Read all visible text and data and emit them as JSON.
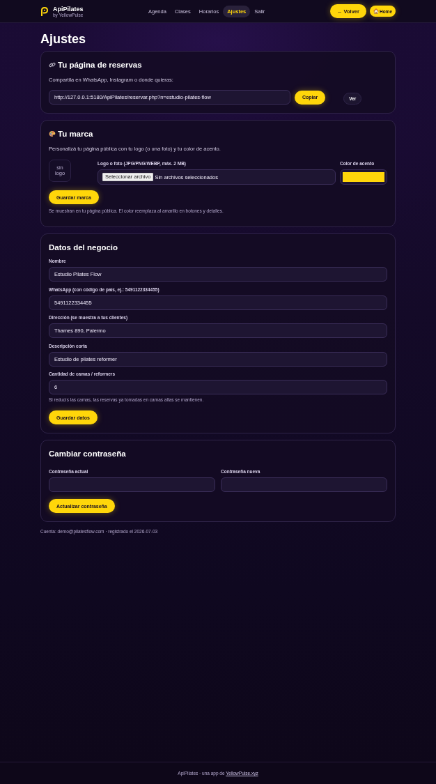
{
  "header": {
    "brand": {
      "name": "ApiPilates",
      "tagline": "by YellowPulse"
    },
    "nav": [
      {
        "label": "Agenda",
        "selected": false
      },
      {
        "label": "Clases",
        "selected": false
      },
      {
        "label": "Horarios",
        "selected": false
      },
      {
        "label": "Ajustes",
        "selected": true
      },
      {
        "label": "Salir",
        "selected": false
      }
    ],
    "actions": [
      {
        "kind": "back",
        "label": "← Volver"
      },
      {
        "kind": "home",
        "label": "Home"
      }
    ]
  },
  "page_title": "Ajustes",
  "sections": [
    {
      "kind": "share",
      "title": "Tu página de reservas",
      "description": "Compartila en WhatsApp, Instagram o donde quieras:",
      "url": "http://127.0.0.1:5180/ApiPilates/reservar.php?n=estudio-pilates-flow",
      "buttons": [
        {
          "kind": "primary",
          "label": "Copiar"
        },
        {
          "kind": "secondary",
          "label": "Ver"
        }
      ]
    },
    {
      "kind": "brand",
      "title": "Tu marca",
      "description": "Personalizá tu página pública con tu logo (o una foto) y tu color de acento.",
      "logo_placeholder": "sin logo",
      "file": {
        "label": "Logo o foto (JPG/PNG/WEBP, máx. 2 MB)",
        "button": "Seleccionar archivo",
        "status": "Sin archivos seleccionados"
      },
      "accent": {
        "label": "Color de acento",
        "color": "#ffd60a"
      },
      "button": "Guardar marca",
      "note": "Se muestran en tu página pública. El color reemplaza al amarillo en botones y detalles."
    },
    {
      "kind": "business",
      "title": "Datos del negocio",
      "fields": [
        {
          "label": "Nombre",
          "value": "Estudio Pilates Flow"
        },
        {
          "label": "WhatsApp (con código de país, ej.: 5491122334455)",
          "value": "5491122334455"
        },
        {
          "label": "Dirección (se muestra a tus clientes)",
          "value": "Thames 890, Palermo"
        },
        {
          "label": "Descripción corta",
          "value": "Estudio de pilates reformer"
        },
        {
          "label": "Cantidad de camas / reformers",
          "value": "6"
        }
      ],
      "hint": "Si reducís las camas, las reservas ya tomadas en camas altas se mantienen.",
      "button": "Guardar datos"
    },
    {
      "kind": "password",
      "title": "Cambiar contraseña",
      "fields": [
        {
          "label": "Contraseña actual"
        },
        {
          "label": "Contraseña nueva"
        }
      ],
      "button": "Actualizar contraseña"
    }
  ],
  "account": "Cuenta: demo@pilatesflow.com · registrado el 2026-07-03",
  "footer": {
    "text": "ApiPilates · una app de",
    "link": "YellowPulse.xyz"
  }
}
